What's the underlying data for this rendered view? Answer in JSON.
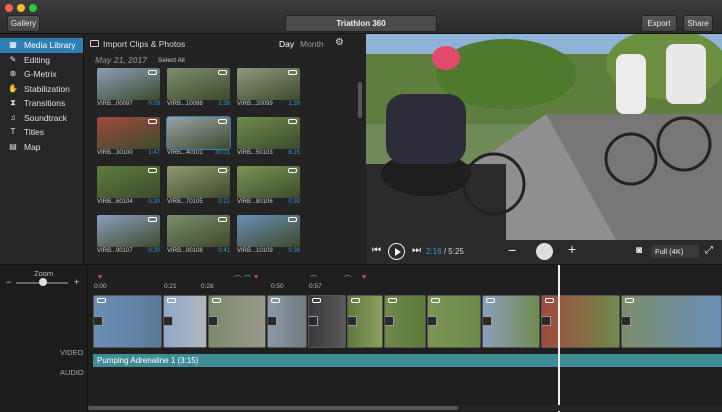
{
  "window": {
    "title": "Triathlon 360"
  },
  "toolbar": {
    "gallery": "Gallery",
    "export": "Export",
    "share": "Share"
  },
  "sidebar": {
    "items": [
      {
        "label": "Media Library",
        "icon": "film-icon",
        "active": true
      },
      {
        "label": "Editing",
        "icon": "edit-icon"
      },
      {
        "label": "G-Metrix",
        "icon": "gauge-icon"
      },
      {
        "label": "Stabilization",
        "icon": "hand-icon"
      },
      {
        "label": "Transitions",
        "icon": "transition-icon"
      },
      {
        "label": "Soundtrack",
        "icon": "music-icon"
      },
      {
        "label": "Titles",
        "icon": "text-icon"
      },
      {
        "label": "Map",
        "icon": "map-icon"
      }
    ]
  },
  "media": {
    "import_label": "Import Clips & Photos",
    "view_day": "Day",
    "view_month": "Month",
    "date": "May 21, 2017",
    "select_all": "Select All",
    "clips": [
      {
        "name": "VIRB...00097",
        "dur": "0:09",
        "color": "#8aa0b8"
      },
      {
        "name": "VIRB...10098",
        "dur": "1:26",
        "color": "#7c8f6c"
      },
      {
        "name": "VIRB...20099",
        "dur": "1:28",
        "color": "#8f9a7a"
      },
      {
        "name": "VIRB...30100",
        "dur": "1:47",
        "color": "#a04a3e"
      },
      {
        "name": "VIRB...40101",
        "dur": "30:01",
        "color": "#9aa3a8"
      },
      {
        "name": "VIRB...50103",
        "dur": "6:15",
        "color": "#6f8a4c"
      },
      {
        "name": "VIRB...60104",
        "dur": "0:30",
        "color": "#5f7d3e"
      },
      {
        "name": "VIRB...70105",
        "dur": "0:21",
        "color": "#8f9b6f"
      },
      {
        "name": "VIRB...80106",
        "dur": "0:30",
        "color": "#7a9554"
      },
      {
        "name": "VIRB...90107",
        "dur": "0:30",
        "color": "#8aa0c0"
      },
      {
        "name": "VIRB...00108",
        "dur": "0:41",
        "color": "#7b8e6a"
      },
      {
        "name": "VIRB...10109",
        "dur": "0:36",
        "color": "#6a8fb8"
      }
    ]
  },
  "player": {
    "current": "2:16",
    "total": "5:25",
    "quality": "Full (4K)"
  },
  "timeline": {
    "zoom_label": "Zoom",
    "zoom_level": 0.52,
    "ticks": [
      "0:00",
      "0:21",
      "0:28",
      "0:50",
      "0:57"
    ],
    "video_label": "VIDEO",
    "audio_label": "AUDIO",
    "audio_clip": "Pumping Adrenaline 1  (3:15)"
  },
  "colors": {
    "accent": "#2f7fb5",
    "audio": "#3f8c95",
    "timecode": "#2f9fd8"
  }
}
